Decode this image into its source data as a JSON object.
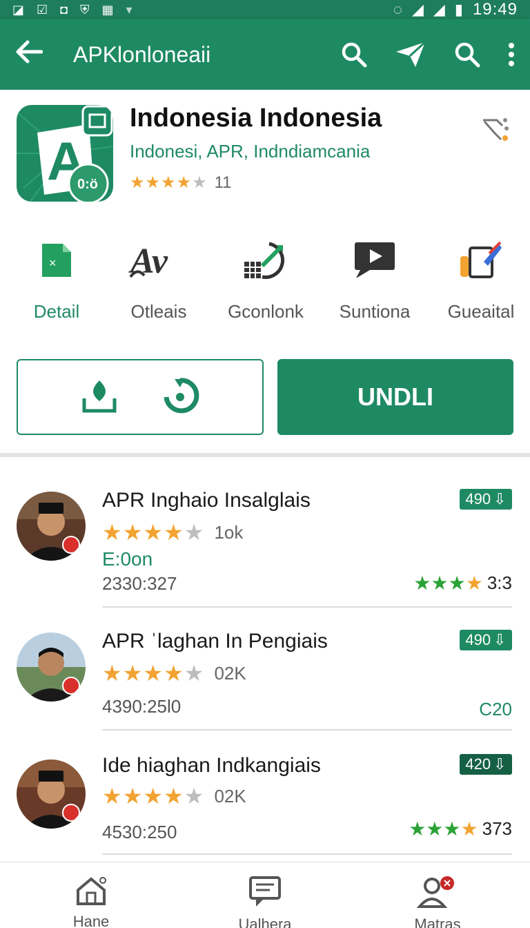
{
  "status_bar": {
    "time": "19:49"
  },
  "app_bar": {
    "title": "APKlonloneaii"
  },
  "app": {
    "name": "Indonesia Indonesia",
    "subtitle": "Indonesi, APR, Indndiamcania",
    "rating_value": 4,
    "rating_count": "11",
    "icon_badge": "0:ö"
  },
  "tabs": [
    {
      "label": "Detail",
      "icon": "sheet-icon"
    },
    {
      "label": "Otleais",
      "icon": "av-icon"
    },
    {
      "label": "Gconlonk",
      "icon": "chart-icon"
    },
    {
      "label": "Suntiona",
      "icon": "video-icon"
    },
    {
      "label": "Gueaital",
      "icon": "clipboard-icon"
    }
  ],
  "primary_button": {
    "label": "UNDLI"
  },
  "items": [
    {
      "title": "APR Inghaio Insalglais",
      "stars": 4,
      "count": "1ok",
      "tag": "E:0on",
      "date": "2330:327",
      "pill": "490",
      "right_rating": "3:3",
      "right_text": ""
    },
    {
      "title": "APR ˈlaghan In Pengiais",
      "stars": 4,
      "count": "02K",
      "tag": "",
      "date": "4390:25l0",
      "pill": "490",
      "right_rating": "",
      "right_text": "C20"
    },
    {
      "title": "Ide hiaghan Indkangiais",
      "stars": 4,
      "count": "02K",
      "tag": "",
      "date": "4530:250",
      "pill": "420",
      "right_rating": "373",
      "right_text": ""
    }
  ],
  "bottom_nav": [
    {
      "label": "Hane",
      "icon": "home-icon"
    },
    {
      "label": "Ualhera",
      "icon": "message-icon"
    },
    {
      "label": "Matras",
      "icon": "account-icon"
    }
  ],
  "colors": {
    "primary": "#1e8a63",
    "status_bar": "#1d7d5c",
    "star": "#f2a332",
    "star_green": "#2aa236",
    "badge_red": "#d9302c"
  }
}
